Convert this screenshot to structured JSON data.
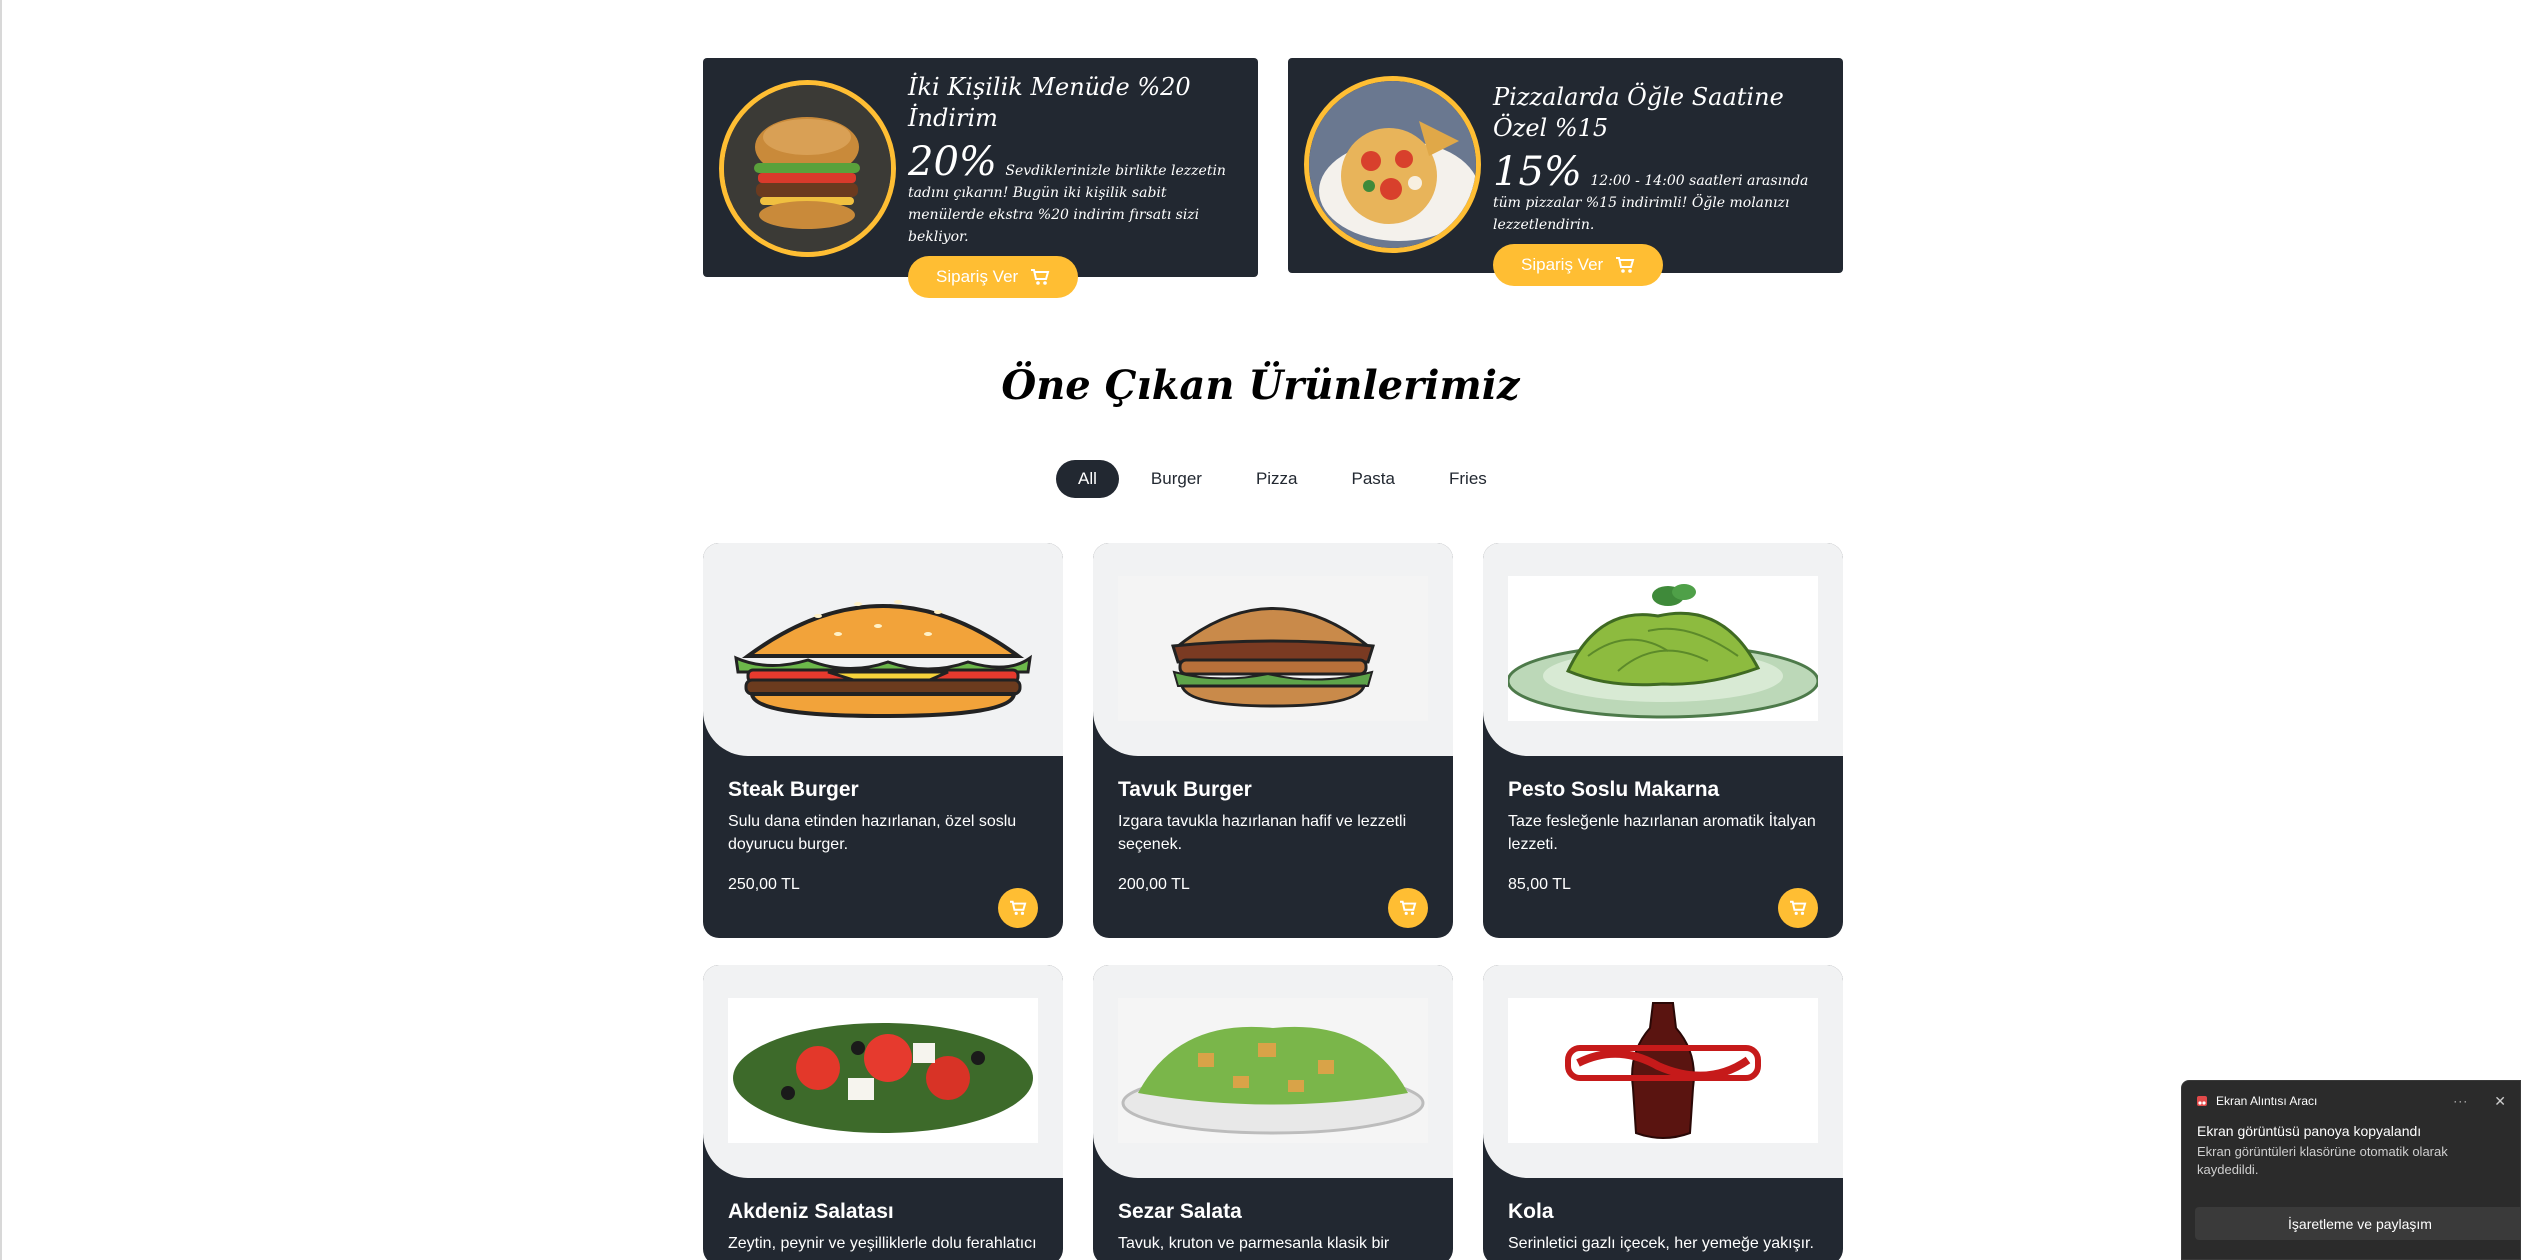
{
  "offers": [
    {
      "title": "İki Kişilik Menüde %20 İndirim",
      "percent": "20%",
      "text": "Sevdiklerinizle birlikte lezzetin tadını çıkarın! Bugün iki kişilik sabit menülerde ekstra %20 indirim fırsatı sizi bekliyor.",
      "button": "Sipariş Ver",
      "image": "burger-photo"
    },
    {
      "title": "Pizzalarda Öğle Saatine Özel %15",
      "percent": "15%",
      "text": "12:00 - 14:00 saatleri arasında tüm pizzalar %15 indirimli! Öğle molanızı lezzetlendirin.",
      "button": "Sipariş Ver",
      "image": "pizza-photo"
    }
  ],
  "section_title": "Öne Çıkan Ürünlerimiz",
  "filters": [
    "All",
    "Burger",
    "Pizza",
    "Pasta",
    "Fries"
  ],
  "active_filter": "All",
  "products": [
    {
      "name": "Steak Burger",
      "description": "Sulu dana etinden hazırlanan, özel soslu doyurucu burger.",
      "price": "250,00 TL",
      "image": "burger-illustration"
    },
    {
      "name": "Tavuk Burger",
      "description": "Izgara tavukla hazırlanan hafif ve lezzetli seçenek.",
      "price": "200,00 TL",
      "image": "chicken-burger-illustration"
    },
    {
      "name": "Pesto Soslu Makarna",
      "description": "Taze fesleğenle hazırlanan aromatik İtalyan lezzeti.",
      "price": "85,00 TL",
      "image": "pesto-pasta"
    },
    {
      "name": "Akdeniz Salatası",
      "description": "Zeytin, peynir ve yeşilliklerle dolu ferahlatıcı",
      "price": "",
      "image": "mediterranean-salad"
    },
    {
      "name": "Sezar Salata",
      "description": "Tavuk, kruton ve parmesanla klasik bir sezar",
      "price": "",
      "image": "caesar-salad"
    },
    {
      "name": "Kola",
      "description": "Serinletici gazlı içecek, her yemeğe yakışır.",
      "price": "",
      "image": "cola-bottle"
    }
  ],
  "toast": {
    "app_name": "Ekran Alıntısı Aracı",
    "more": "···",
    "close": "✕",
    "title": "Ekran görüntüsü panoya kopyalandı",
    "message": "Ekran görüntüleri klasörüne otomatik olarak kaydedildi.",
    "button": "İşaretleme ve paylaşım"
  },
  "colors": {
    "dark": "#222831",
    "accent": "#ffbe33",
    "card_image_bg": "#f1f2f3"
  }
}
